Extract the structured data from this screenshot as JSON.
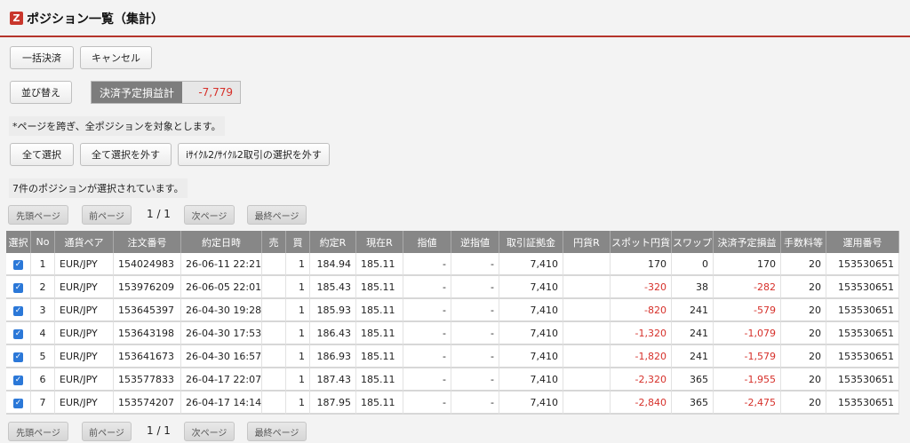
{
  "header": {
    "logo": "Z",
    "title": "ポジション一覧（集計）"
  },
  "buttons": {
    "bulk_settle": "一括決済",
    "cancel": "キャンセル",
    "sort": "並び替え",
    "select_all": "全て選択",
    "deselect_all": "全て選択を外す",
    "deselect_cycle": "iｻｲｸﾙ2/ｻｲｸﾙ2取引の選択を外す"
  },
  "summary": {
    "label": "決済予定損益計",
    "value": "-7,779"
  },
  "notes": {
    "cross_page": "*ページを跨ぎ、全ポジションを対象とします。",
    "selected_count": "7件のポジションが選択されています。"
  },
  "pager": {
    "first": "先頭ページ",
    "prev": "前ページ",
    "info": "1 / 1",
    "next": "次ページ",
    "last": "最終ページ"
  },
  "table": {
    "headers": [
      "選択",
      "No",
      "通貨ペア",
      "注文番号",
      "約定日時",
      "売",
      "買",
      "約定R",
      "現在R",
      "指値",
      "逆指値",
      "取引証拠金",
      "円貨R",
      "スポット円貨",
      "スワップ",
      "決済予定損益",
      "手数料等",
      "運用番号"
    ],
    "rows": [
      {
        "no": "1",
        "pair": "EUR/JPY",
        "order": "154024983",
        "datetime": "26-06-11 22:21",
        "sell": "",
        "buy": "1",
        "exec_rate": "184.94",
        "current_rate": "185.11",
        "limit": "-",
        "stop": "-",
        "margin": "7,410",
        "yen_rate": "",
        "spot_yen": "170",
        "swap": "0",
        "pnl": "170",
        "fee": "20",
        "account": "153530651"
      },
      {
        "no": "2",
        "pair": "EUR/JPY",
        "order": "153976209",
        "datetime": "26-06-05 22:01",
        "sell": "",
        "buy": "1",
        "exec_rate": "185.43",
        "current_rate": "185.11",
        "limit": "-",
        "stop": "-",
        "margin": "7,410",
        "yen_rate": "",
        "spot_yen": "-320",
        "swap": "38",
        "pnl": "-282",
        "fee": "20",
        "account": "153530651"
      },
      {
        "no": "3",
        "pair": "EUR/JPY",
        "order": "153645397",
        "datetime": "26-04-30 19:28",
        "sell": "",
        "buy": "1",
        "exec_rate": "185.93",
        "current_rate": "185.11",
        "limit": "-",
        "stop": "-",
        "margin": "7,410",
        "yen_rate": "",
        "spot_yen": "-820",
        "swap": "241",
        "pnl": "-579",
        "fee": "20",
        "account": "153530651"
      },
      {
        "no": "4",
        "pair": "EUR/JPY",
        "order": "153643198",
        "datetime": "26-04-30 17:53",
        "sell": "",
        "buy": "1",
        "exec_rate": "186.43",
        "current_rate": "185.11",
        "limit": "-",
        "stop": "-",
        "margin": "7,410",
        "yen_rate": "",
        "spot_yen": "-1,320",
        "swap": "241",
        "pnl": "-1,079",
        "fee": "20",
        "account": "153530651"
      },
      {
        "no": "5",
        "pair": "EUR/JPY",
        "order": "153641673",
        "datetime": "26-04-30 16:57",
        "sell": "",
        "buy": "1",
        "exec_rate": "186.93",
        "current_rate": "185.11",
        "limit": "-",
        "stop": "-",
        "margin": "7,410",
        "yen_rate": "",
        "spot_yen": "-1,820",
        "swap": "241",
        "pnl": "-1,579",
        "fee": "20",
        "account": "153530651"
      },
      {
        "no": "6",
        "pair": "EUR/JPY",
        "order": "153577833",
        "datetime": "26-04-17 22:07",
        "sell": "",
        "buy": "1",
        "exec_rate": "187.43",
        "current_rate": "185.11",
        "limit": "-",
        "stop": "-",
        "margin": "7,410",
        "yen_rate": "",
        "spot_yen": "-2,320",
        "swap": "365",
        "pnl": "-1,955",
        "fee": "20",
        "account": "153530651"
      },
      {
        "no": "7",
        "pair": "EUR/JPY",
        "order": "153574207",
        "datetime": "26-04-17 14:14",
        "sell": "",
        "buy": "1",
        "exec_rate": "187.95",
        "current_rate": "185.11",
        "limit": "-",
        "stop": "-",
        "margin": "7,410",
        "yen_rate": "",
        "spot_yen": "-2,840",
        "swap": "365",
        "pnl": "-2,475",
        "fee": "20",
        "account": "153530651"
      }
    ]
  },
  "colors": {
    "accent": "#c9372c",
    "negative": "#d6302a",
    "header_bg": "#878787",
    "checkbox": "#2b78d8"
  },
  "icons": {
    "checkbox": "checkbox-checked-icon"
  }
}
